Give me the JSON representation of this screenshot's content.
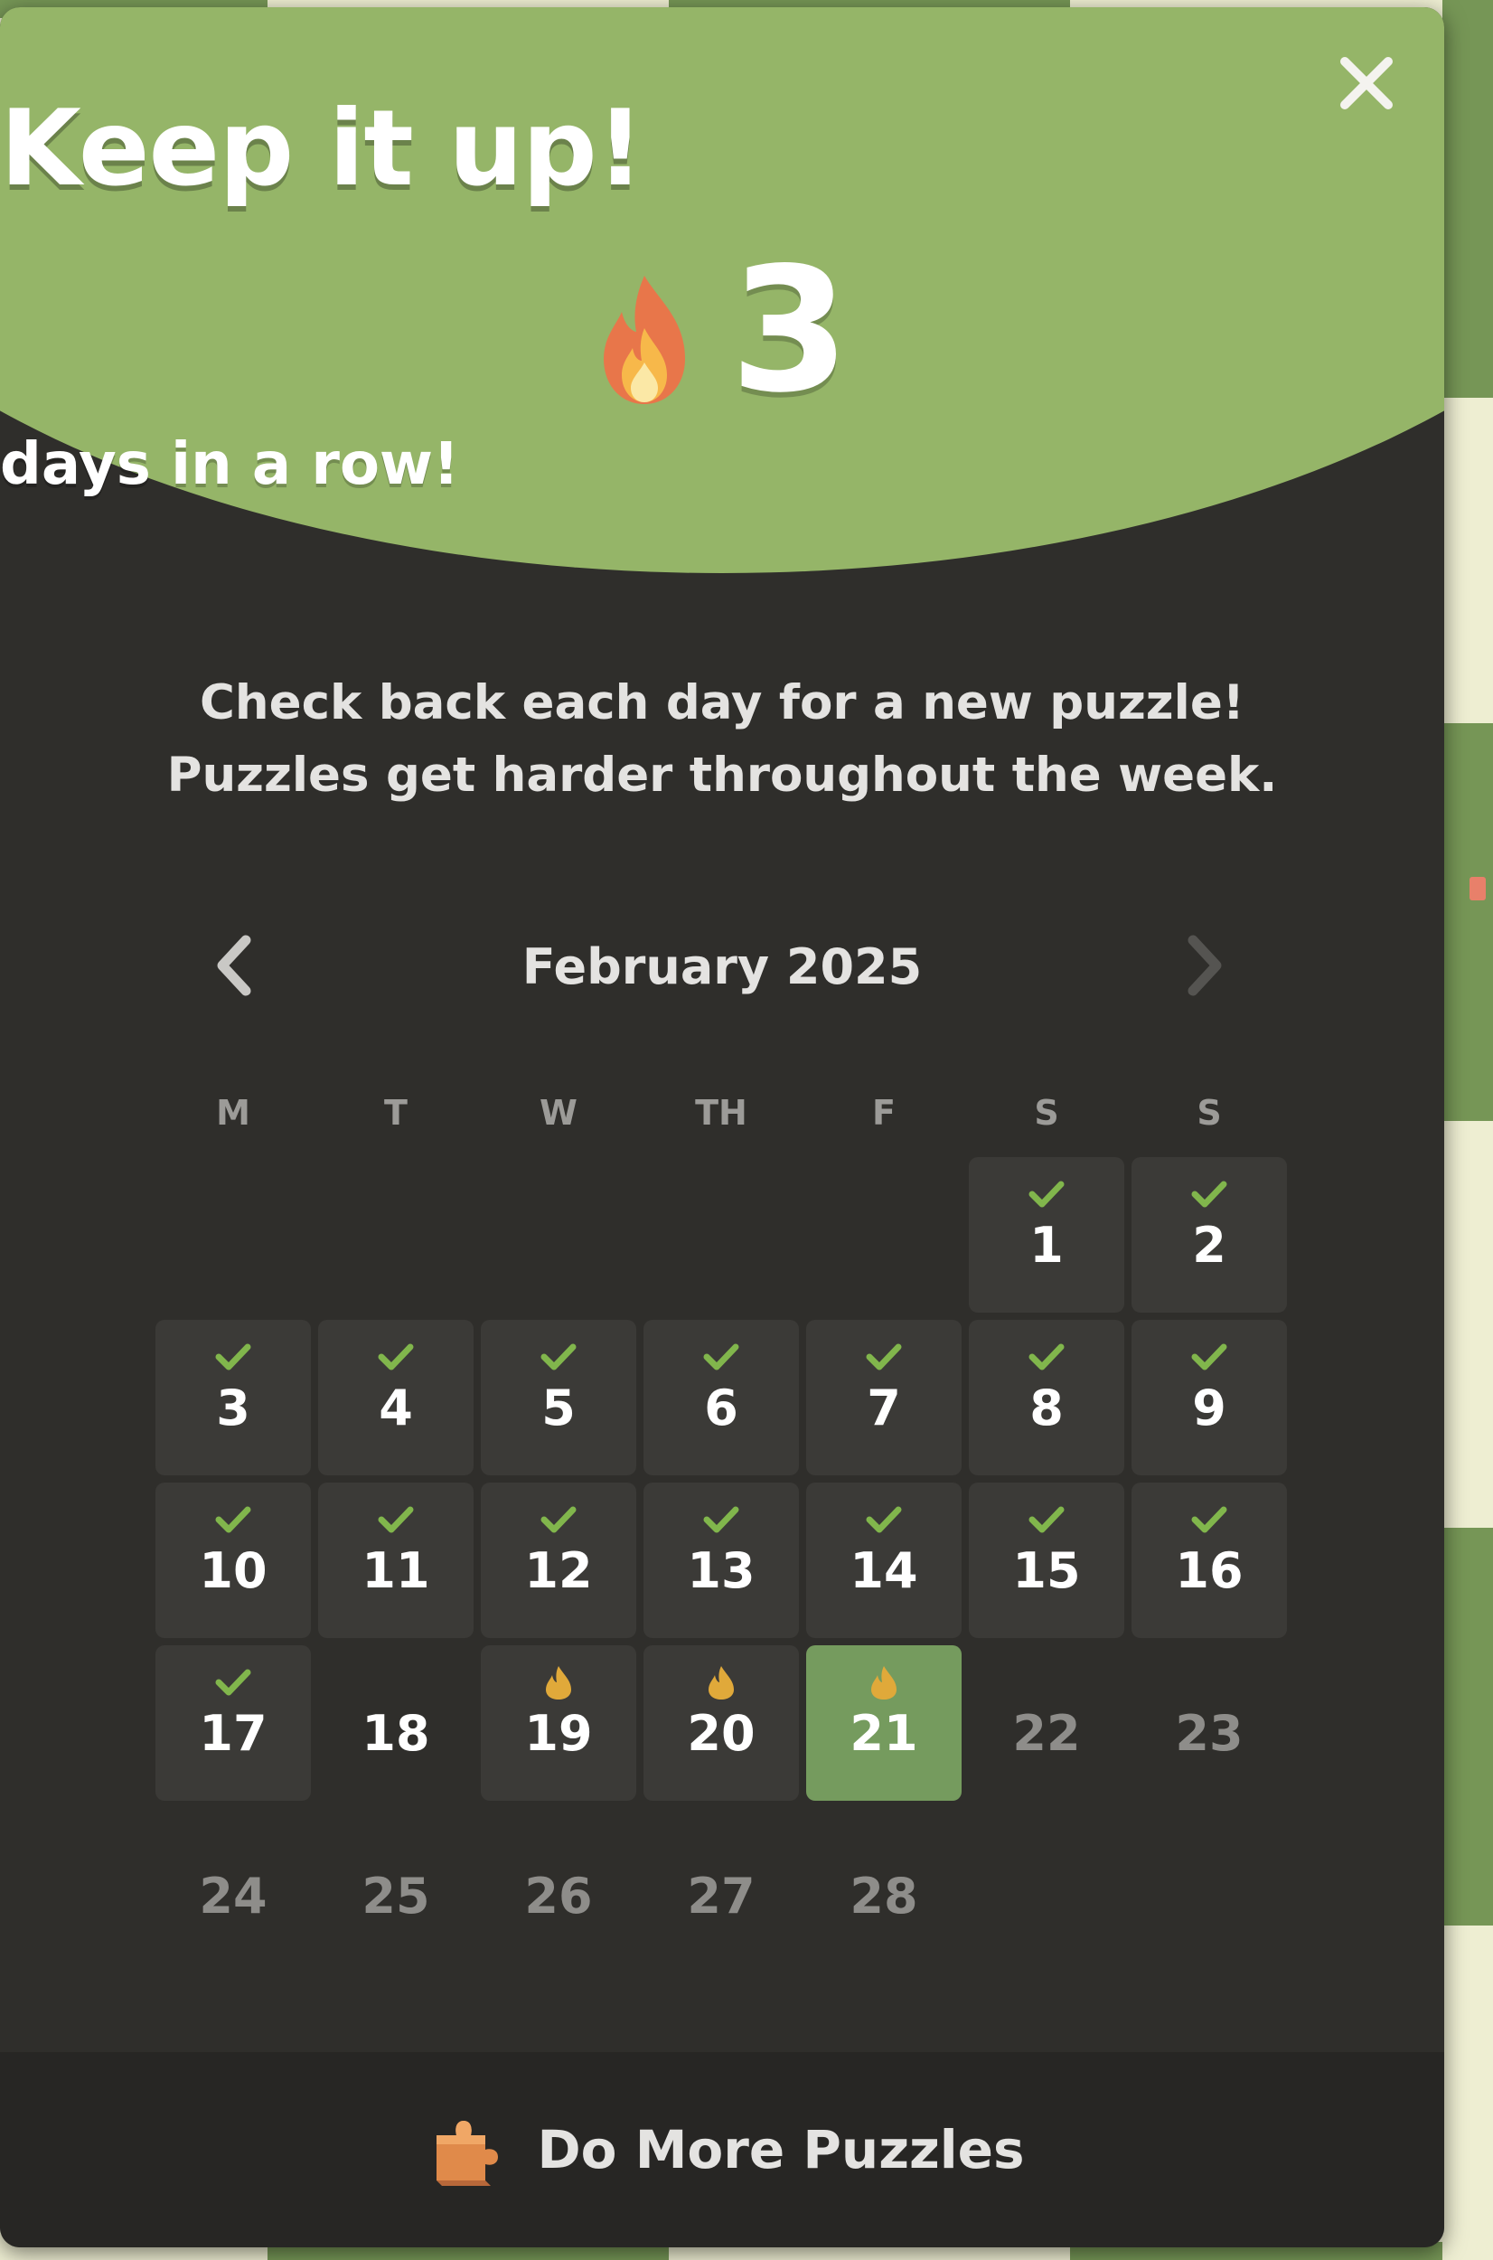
{
  "popup": {
    "title": "Keep it up!",
    "streak_count": "3",
    "streak_label": "days in a row!",
    "message_line1": "Check back each day for a new puzzle!",
    "message_line2": "Puzzles get harder throughout the week.",
    "close_icon": "close-icon"
  },
  "calendar": {
    "month_label": "February 2025",
    "prev_icon": "chevron-left-icon",
    "next_icon": "chevron-right-icon",
    "weekdays": [
      "M",
      "T",
      "W",
      "TH",
      "F",
      "S",
      "S"
    ],
    "leading_blanks": 5,
    "days": [
      {
        "day": "1",
        "status": "solved"
      },
      {
        "day": "2",
        "status": "solved"
      },
      {
        "day": "3",
        "status": "solved"
      },
      {
        "day": "4",
        "status": "solved"
      },
      {
        "day": "5",
        "status": "solved"
      },
      {
        "day": "6",
        "status": "solved"
      },
      {
        "day": "7",
        "status": "solved"
      },
      {
        "day": "8",
        "status": "solved"
      },
      {
        "day": "9",
        "status": "solved"
      },
      {
        "day": "10",
        "status": "solved"
      },
      {
        "day": "11",
        "status": "solved"
      },
      {
        "day": "12",
        "status": "solved"
      },
      {
        "day": "13",
        "status": "solved"
      },
      {
        "day": "14",
        "status": "solved"
      },
      {
        "day": "15",
        "status": "solved"
      },
      {
        "day": "16",
        "status": "solved"
      },
      {
        "day": "17",
        "status": "solved"
      },
      {
        "day": "18",
        "status": "missed"
      },
      {
        "day": "19",
        "status": "streak"
      },
      {
        "day": "20",
        "status": "streak"
      },
      {
        "day": "21",
        "status": "today-streak"
      },
      {
        "day": "22",
        "status": "future"
      },
      {
        "day": "23",
        "status": "future"
      },
      {
        "day": "24",
        "status": "future"
      },
      {
        "day": "25",
        "status": "future"
      },
      {
        "day": "26",
        "status": "future"
      },
      {
        "day": "27",
        "status": "future"
      },
      {
        "day": "28",
        "status": "future"
      }
    ]
  },
  "footer": {
    "button_label": "Do More Puzzles",
    "icon": "puzzle-piece-icon"
  },
  "colors": {
    "hero_green": "#95b568",
    "panel_bg": "#2f2e2b",
    "cell_bg": "#3b3a37",
    "today_bg": "#759b5e",
    "check_green": "#81b64c",
    "flame_gold": "#e0a93a",
    "footer_bg": "#272624"
  }
}
